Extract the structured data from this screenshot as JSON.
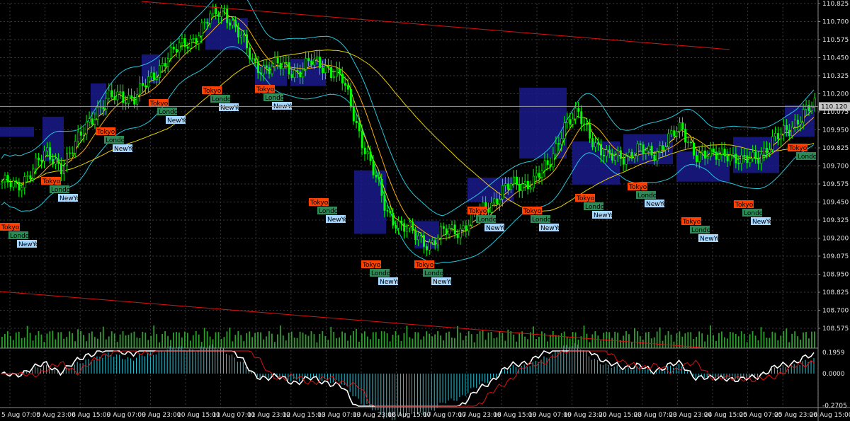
{
  "colors": {
    "background": "#000000",
    "grid": "#3a3a3a",
    "axis": "#8a8a8a",
    "text": "#e6e6e6",
    "bull_candle": "#00ff00",
    "ma_fast": "#ffd400",
    "ma_slow": "#ffb000",
    "bands": "#26c6da",
    "trendline": "#e01010",
    "range_box": "#1a1a8c",
    "volume": "#2e9e2e",
    "tokyo_tag": "#ff4000",
    "london_tag": "#2e8b57",
    "newyork_tag": "#a8d8ff",
    "osc_main": "#ffffff",
    "osc_signal": "#e01010",
    "osc_hist": "#26c6da"
  },
  "price_axis": {
    "labels": [
      "110.825",
      "110.700",
      "110.575",
      "110.450",
      "110.325",
      "110.200",
      "110.075",
      "109.950",
      "109.825",
      "109.700",
      "109.575",
      "109.450",
      "109.325",
      "109.200",
      "109.075",
      "108.950",
      "108.825",
      "108.700",
      "108.575"
    ],
    "current_price": "110.120"
  },
  "oscillator_axis": {
    "labels": [
      "0.1959",
      "0.0000",
      "-0.2705"
    ]
  },
  "time_axis": {
    "labels": [
      "5 Aug 07:00",
      "5 Aug 23:00",
      "6 Aug 15:00",
      "9 Aug 07:00",
      "9 Aug 23:00",
      "10 Aug 15:00",
      "11 Aug 07:00",
      "11 Aug 23:00",
      "12 Aug 15:00",
      "13 Aug 07:00",
      "13 Aug 23:00",
      "16 Aug 15:00",
      "17 Aug 07:00",
      "17 Aug 23:00",
      "18 Aug 15:00",
      "19 Aug 07:00",
      "19 Aug 23:00",
      "20 Aug 15:00",
      "23 Aug 07:00",
      "23 Aug 23:00",
      "24 Aug 15:00",
      "25 Aug 07:00",
      "25 Aug 23:00",
      "26 Aug 15:00"
    ]
  },
  "sessions": {
    "tokyo": "Tokyo",
    "london": "London",
    "newyork": "NewYo"
  },
  "chart_data": {
    "type": "candlestick",
    "symbol_axis": "price",
    "ylim": [
      108.55,
      110.83
    ],
    "closes": [
      109.6,
      109.55,
      109.7,
      109.78,
      109.72,
      109.85,
      110.05,
      110.15,
      110.2,
      110.18,
      110.3,
      110.45,
      110.52,
      110.6,
      110.72,
      110.8,
      110.62,
      110.42,
      110.38,
      110.4,
      110.36,
      110.42,
      110.4,
      110.3,
      110.0,
      109.7,
      109.4,
      109.3,
      109.22,
      109.18,
      109.25,
      109.28,
      109.35,
      109.45,
      109.55,
      109.58,
      109.62,
      109.7,
      110.0,
      110.05,
      109.9,
      109.75,
      109.78,
      109.82,
      109.78,
      109.9,
      109.95,
      109.8,
      109.76,
      109.82,
      109.72,
      109.78,
      109.85,
      109.95,
      110.05,
      110.12
    ]
  },
  "tooltip": null
}
